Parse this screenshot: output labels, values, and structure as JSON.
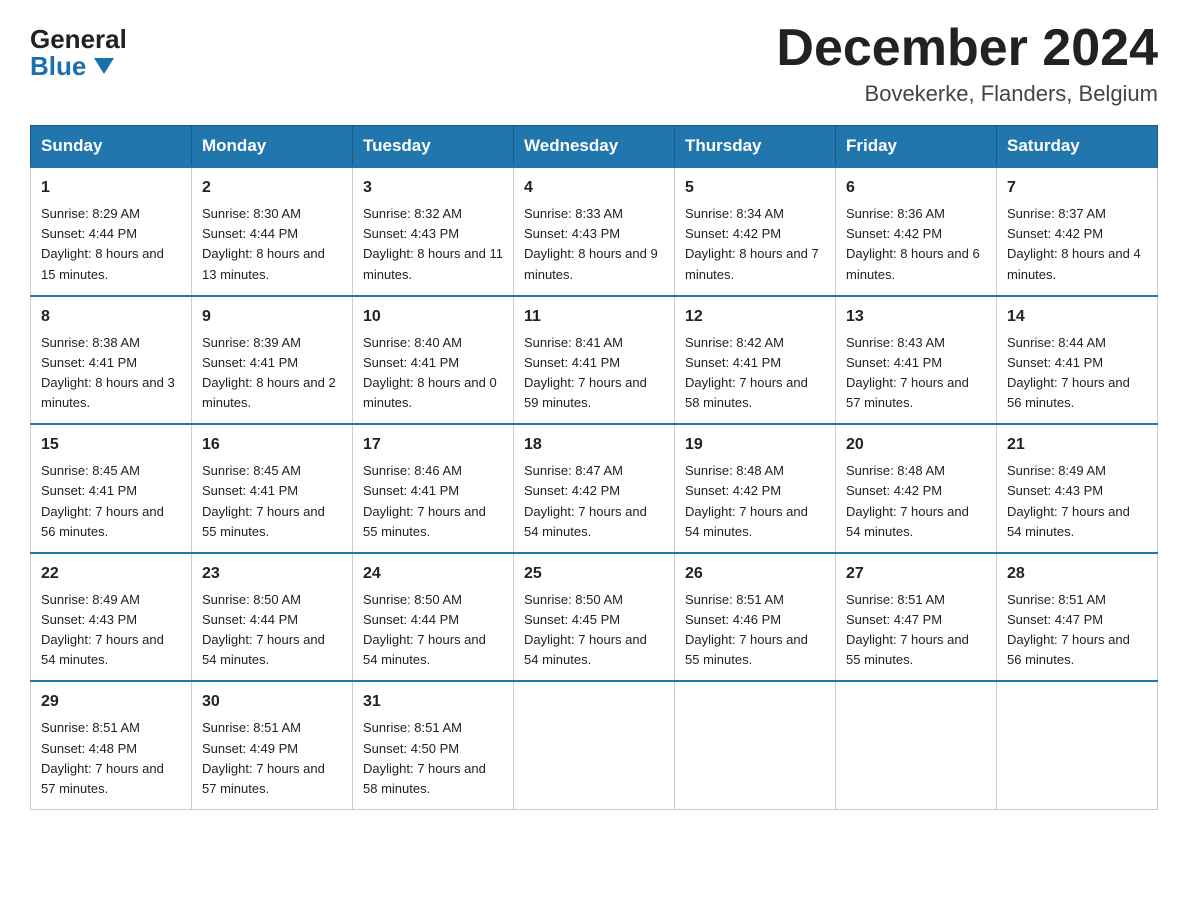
{
  "logo": {
    "general": "General",
    "blue": "Blue"
  },
  "title": "December 2024",
  "location": "Bovekerke, Flanders, Belgium",
  "days_of_week": [
    "Sunday",
    "Monday",
    "Tuesday",
    "Wednesday",
    "Thursday",
    "Friday",
    "Saturday"
  ],
  "weeks": [
    [
      {
        "day": "1",
        "sunrise": "8:29 AM",
        "sunset": "4:44 PM",
        "daylight": "8 hours and 15 minutes."
      },
      {
        "day": "2",
        "sunrise": "8:30 AM",
        "sunset": "4:44 PM",
        "daylight": "8 hours and 13 minutes."
      },
      {
        "day": "3",
        "sunrise": "8:32 AM",
        "sunset": "4:43 PM",
        "daylight": "8 hours and 11 minutes."
      },
      {
        "day": "4",
        "sunrise": "8:33 AM",
        "sunset": "4:43 PM",
        "daylight": "8 hours and 9 minutes."
      },
      {
        "day": "5",
        "sunrise": "8:34 AM",
        "sunset": "4:42 PM",
        "daylight": "8 hours and 7 minutes."
      },
      {
        "day": "6",
        "sunrise": "8:36 AM",
        "sunset": "4:42 PM",
        "daylight": "8 hours and 6 minutes."
      },
      {
        "day": "7",
        "sunrise": "8:37 AM",
        "sunset": "4:42 PM",
        "daylight": "8 hours and 4 minutes."
      }
    ],
    [
      {
        "day": "8",
        "sunrise": "8:38 AM",
        "sunset": "4:41 PM",
        "daylight": "8 hours and 3 minutes."
      },
      {
        "day": "9",
        "sunrise": "8:39 AM",
        "sunset": "4:41 PM",
        "daylight": "8 hours and 2 minutes."
      },
      {
        "day": "10",
        "sunrise": "8:40 AM",
        "sunset": "4:41 PM",
        "daylight": "8 hours and 0 minutes."
      },
      {
        "day": "11",
        "sunrise": "8:41 AM",
        "sunset": "4:41 PM",
        "daylight": "7 hours and 59 minutes."
      },
      {
        "day": "12",
        "sunrise": "8:42 AM",
        "sunset": "4:41 PM",
        "daylight": "7 hours and 58 minutes."
      },
      {
        "day": "13",
        "sunrise": "8:43 AM",
        "sunset": "4:41 PM",
        "daylight": "7 hours and 57 minutes."
      },
      {
        "day": "14",
        "sunrise": "8:44 AM",
        "sunset": "4:41 PM",
        "daylight": "7 hours and 56 minutes."
      }
    ],
    [
      {
        "day": "15",
        "sunrise": "8:45 AM",
        "sunset": "4:41 PM",
        "daylight": "7 hours and 56 minutes."
      },
      {
        "day": "16",
        "sunrise": "8:45 AM",
        "sunset": "4:41 PM",
        "daylight": "7 hours and 55 minutes."
      },
      {
        "day": "17",
        "sunrise": "8:46 AM",
        "sunset": "4:41 PM",
        "daylight": "7 hours and 55 minutes."
      },
      {
        "day": "18",
        "sunrise": "8:47 AM",
        "sunset": "4:42 PM",
        "daylight": "7 hours and 54 minutes."
      },
      {
        "day": "19",
        "sunrise": "8:48 AM",
        "sunset": "4:42 PM",
        "daylight": "7 hours and 54 minutes."
      },
      {
        "day": "20",
        "sunrise": "8:48 AM",
        "sunset": "4:42 PM",
        "daylight": "7 hours and 54 minutes."
      },
      {
        "day": "21",
        "sunrise": "8:49 AM",
        "sunset": "4:43 PM",
        "daylight": "7 hours and 54 minutes."
      }
    ],
    [
      {
        "day": "22",
        "sunrise": "8:49 AM",
        "sunset": "4:43 PM",
        "daylight": "7 hours and 54 minutes."
      },
      {
        "day": "23",
        "sunrise": "8:50 AM",
        "sunset": "4:44 PM",
        "daylight": "7 hours and 54 minutes."
      },
      {
        "day": "24",
        "sunrise": "8:50 AM",
        "sunset": "4:44 PM",
        "daylight": "7 hours and 54 minutes."
      },
      {
        "day": "25",
        "sunrise": "8:50 AM",
        "sunset": "4:45 PM",
        "daylight": "7 hours and 54 minutes."
      },
      {
        "day": "26",
        "sunrise": "8:51 AM",
        "sunset": "4:46 PM",
        "daylight": "7 hours and 55 minutes."
      },
      {
        "day": "27",
        "sunrise": "8:51 AM",
        "sunset": "4:47 PM",
        "daylight": "7 hours and 55 minutes."
      },
      {
        "day": "28",
        "sunrise": "8:51 AM",
        "sunset": "4:47 PM",
        "daylight": "7 hours and 56 minutes."
      }
    ],
    [
      {
        "day": "29",
        "sunrise": "8:51 AM",
        "sunset": "4:48 PM",
        "daylight": "7 hours and 57 minutes."
      },
      {
        "day": "30",
        "sunrise": "8:51 AM",
        "sunset": "4:49 PM",
        "daylight": "7 hours and 57 minutes."
      },
      {
        "day": "31",
        "sunrise": "8:51 AM",
        "sunset": "4:50 PM",
        "daylight": "7 hours and 58 minutes."
      },
      null,
      null,
      null,
      null
    ]
  ]
}
